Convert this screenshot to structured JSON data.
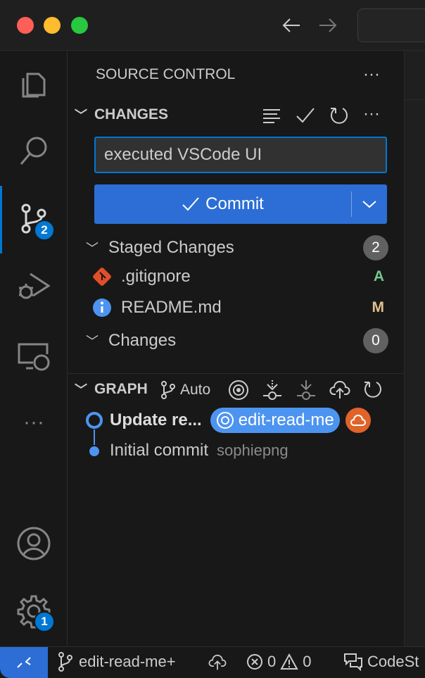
{
  "sidebar": {
    "title": "SOURCE CONTROL",
    "changes_header": "CHANGES",
    "message_value": "executed VSCode UI",
    "commit_label": "Commit",
    "staged": {
      "label": "Staged Changes",
      "count": "2",
      "files": [
        {
          "name": ".gitignore",
          "status": "A",
          "status_color": "#73c991"
        },
        {
          "name": "README.md",
          "status": "M",
          "status_color": "#e2c08d"
        }
      ]
    },
    "changes": {
      "label": "Changes",
      "count": "0"
    },
    "graph": {
      "header": "GRAPH",
      "auto": "Auto",
      "commits": [
        {
          "message": "Update re...",
          "branch": "edit-read-me"
        },
        {
          "message": "Initial commit",
          "author": "sophiepng"
        }
      ]
    }
  },
  "activity": {
    "scm_badge": "2",
    "settings_badge": "1"
  },
  "status": {
    "branch": "edit-read-me+",
    "errors": "0",
    "warnings": "0",
    "extension": "CodeSt"
  },
  "colors": {
    "accent": "#0078d4",
    "button": "#2c6ed5",
    "ref": "#4d94f0",
    "remote": "#e0632a"
  }
}
